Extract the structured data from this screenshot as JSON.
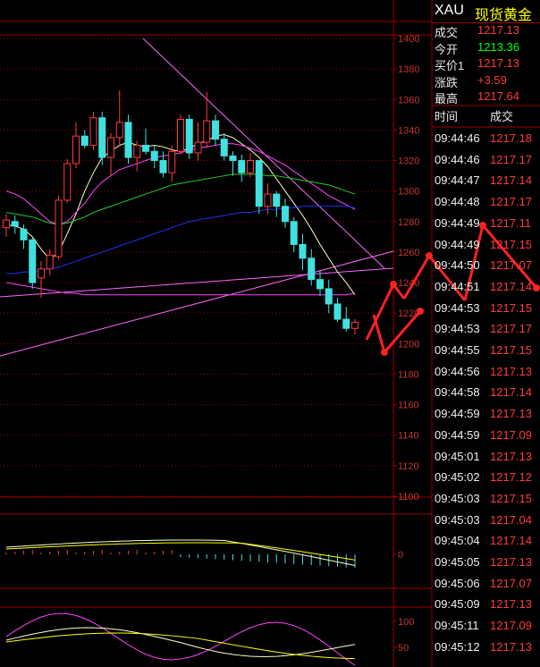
{
  "header": {
    "symbol": "XAU",
    "name": "现货黄金"
  },
  "quote": [
    {
      "label": "成交",
      "value": "1217.13",
      "color": "#ff3b3b"
    },
    {
      "label": "今开",
      "value": "1213.36",
      "color": "#00ff00"
    },
    {
      "label": "买价1",
      "value": "1217.13",
      "color": "#ff3b3b"
    },
    {
      "label": "涨跌",
      "value": "+3.59",
      "color": "#ff3b3b"
    },
    {
      "label": "最高",
      "value": "1217.64",
      "color": "#ff3b3b"
    }
  ],
  "ticks_header": {
    "time": "时间",
    "price": "成交"
  },
  "ticks": [
    {
      "time": "09:44:46",
      "price": "1217.18"
    },
    {
      "time": "09:44:46",
      "price": "1217.17"
    },
    {
      "time": "09:44:47",
      "price": "1217.14"
    },
    {
      "time": "09:44:48",
      "price": "1217.17"
    },
    {
      "time": "09:44:49",
      "price": "1217.11"
    },
    {
      "time": "09:44:49",
      "price": "1217.15"
    },
    {
      "time": "09:44:50",
      "price": "1217.07"
    },
    {
      "time": "09:44:51",
      "price": "1217.14"
    },
    {
      "time": "09:44:53",
      "price": "1217.15"
    },
    {
      "time": "09:44:53",
      "price": "1217.17"
    },
    {
      "time": "09:44:55",
      "price": "1217.15"
    },
    {
      "time": "09:44:56",
      "price": "1217.13"
    },
    {
      "time": "09:44:58",
      "price": "1217.14"
    },
    {
      "time": "09:44:59",
      "price": "1217.13"
    },
    {
      "time": "09:44:59",
      "price": "1217.09"
    },
    {
      "time": "09:45:01",
      "price": "1217.13"
    },
    {
      "time": "09:45:02",
      "price": "1217.12"
    },
    {
      "time": "09:45:03",
      "price": "1217.15"
    },
    {
      "time": "09:45:03",
      "price": "1217.04"
    },
    {
      "time": "09:45:04",
      "price": "1217.14"
    },
    {
      "time": "09:45:05",
      "price": "1217.13"
    },
    {
      "time": "09:45:06",
      "price": "1217.07"
    },
    {
      "time": "09:45:09",
      "price": "1217.13"
    },
    {
      "time": "09:45:11",
      "price": "1217.09"
    },
    {
      "time": "09:45:12",
      "price": "1217.13"
    }
  ],
  "price_axis": [
    "1400",
    "1380",
    "1360",
    "1340",
    "1320",
    "1300",
    "1280",
    "1260",
    "1240",
    "1220",
    "1200",
    "1180",
    "1160",
    "1140",
    "1120",
    "1100"
  ],
  "macd_axis": [
    "0"
  ],
  "kdj_axis": [
    "100",
    "50"
  ],
  "chart_data": {
    "type": "candlestick",
    "ylim": [
      1100,
      1400
    ],
    "up_color": "#ff3b3b",
    "down_color": "#40e0e0",
    "candles": [
      [
        1276,
        1281,
        1270,
        1285
      ],
      [
        1280,
        1277,
        1272,
        1284
      ],
      [
        1275,
        1268,
        1262,
        1278
      ],
      [
        1268,
        1240,
        1236,
        1270
      ],
      [
        1243,
        1249,
        1230,
        1254
      ],
      [
        1249,
        1258,
        1245,
        1262
      ],
      [
        1257,
        1294,
        1255,
        1297
      ],
      [
        1294,
        1318,
        1292,
        1321
      ],
      [
        1318,
        1336,
        1315,
        1345
      ],
      [
        1336,
        1330,
        1328,
        1340
      ],
      [
        1330,
        1348,
        1327,
        1352
      ],
      [
        1348,
        1322,
        1317,
        1352
      ],
      [
        1322,
        1335,
        1310,
        1338
      ],
      [
        1335,
        1345,
        1329,
        1366
      ],
      [
        1345,
        1322,
        1318,
        1350
      ],
      [
        1322,
        1330,
        1313,
        1333
      ],
      [
        1330,
        1326,
        1324,
        1341
      ],
      [
        1326,
        1320,
        1315,
        1330
      ],
      [
        1320,
        1312,
        1309,
        1326
      ],
      [
        1312,
        1326,
        1306,
        1330
      ],
      [
        1326,
        1347,
        1324,
        1350
      ],
      [
        1347,
        1325,
        1321,
        1350
      ],
      [
        1325,
        1332,
        1320,
        1345
      ],
      [
        1332,
        1346,
        1328,
        1365
      ],
      [
        1346,
        1334,
        1330,
        1350
      ],
      [
        1334,
        1323,
        1320,
        1338
      ],
      [
        1323,
        1320,
        1310,
        1326
      ],
      [
        1320,
        1312,
        1306,
        1324
      ],
      [
        1312,
        1320,
        1309,
        1325
      ],
      [
        1320,
        1290,
        1285,
        1320
      ],
      [
        1290,
        1298,
        1285,
        1305
      ],
      [
        1298,
        1290,
        1283,
        1300
      ],
      [
        1290,
        1280,
        1276,
        1295
      ],
      [
        1280,
        1265,
        1260,
        1283
      ],
      [
        1265,
        1256,
        1248,
        1272
      ],
      [
        1256,
        1242,
        1238,
        1262
      ],
      [
        1242,
        1236,
        1231,
        1248
      ],
      [
        1236,
        1226,
        1220,
        1242
      ],
      [
        1226,
        1216,
        1214,
        1230
      ],
      [
        1216,
        1210,
        1208,
        1224
      ],
      [
        1210,
        1214,
        1206,
        1216
      ]
    ],
    "ma_lines": [
      {
        "name": "",
        "color": "#ffffcc",
        "values": [
          1278,
          1277,
          1275,
          1270,
          1262,
          1255,
          1260,
          1272,
          1285,
          1300,
          1312,
          1322,
          1326,
          1330,
          1332,
          1330,
          1329,
          1330,
          1329,
          1327,
          1326,
          1328,
          1331,
          1333,
          1336,
          1337,
          1335,
          1331,
          1327,
          1322,
          1316,
          1308,
          1300,
          1292,
          1284,
          1275,
          1265,
          1256,
          1247,
          1240,
          1232
        ]
      },
      {
        "name": "",
        "color": "#ff44ff",
        "values": [
          1300,
          1298,
          1295,
          1290,
          1285,
          1280,
          1278,
          1280,
          1286,
          1292,
          1300,
          1306,
          1310,
          1314,
          1316,
          1318,
          1320,
          1322,
          1323,
          1324,
          1325,
          1327,
          1328,
          1329,
          1330,
          1331,
          1331,
          1330,
          1328,
          1326,
          1323,
          1320,
          1317,
          1313,
          1309,
          1305,
          1301,
          1297,
          1294,
          1291,
          1288
        ]
      },
      {
        "name": "",
        "color": "#22cc22",
        "values": [
          1286,
          1285,
          1284,
          1283,
          1281,
          1279,
          1278,
          1279,
          1281,
          1283,
          1286,
          1288,
          1290,
          1292,
          1294,
          1296,
          1298,
          1300,
          1302,
          1304,
          1305,
          1306,
          1307,
          1308,
          1309,
          1310,
          1311,
          1311,
          1311,
          1311,
          1310,
          1310,
          1309,
          1308,
          1307,
          1306,
          1305,
          1304,
          1302,
          1300,
          1298
        ]
      },
      {
        "name": "",
        "color": "#2233ee",
        "values": [
          1246,
          1246,
          1247,
          1247,
          1248,
          1249,
          1250,
          1252,
          1254,
          1256,
          1258,
          1260,
          1262,
          1264,
          1266,
          1268,
          1270,
          1272,
          1274,
          1276,
          1278,
          1280,
          1281,
          1282,
          1283,
          1284,
          1285,
          1286,
          1286,
          1287,
          1288,
          1288,
          1289,
          1289,
          1290,
          1290,
          1290,
          1290,
          1290,
          1290,
          1289
        ]
      },
      {
        "name": "",
        "color": "#ff44ff",
        "values": [
          1240,
          1239,
          1238,
          1237,
          1236,
          1235,
          1234,
          1233,
          1233,
          1232,
          1232,
          1232,
          1232,
          1232,
          1232,
          1232,
          1232,
          1232,
          1232,
          1232,
          1232,
          1232,
          1232,
          1232,
          1232,
          1232,
          1232,
          1232,
          1232,
          1232,
          1232,
          1232,
          1232,
          1232,
          1232,
          1232,
          1232,
          1232,
          1232,
          1232,
          1233
        ]
      }
    ]
  }
}
